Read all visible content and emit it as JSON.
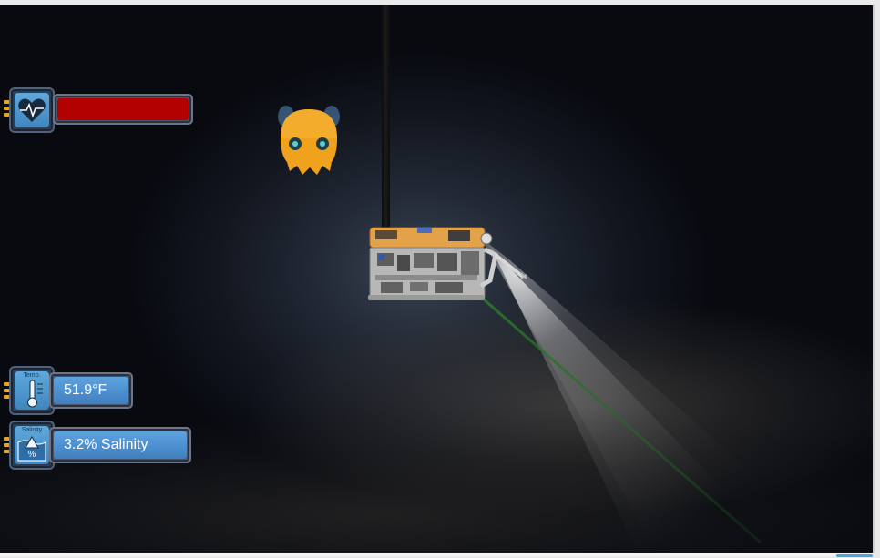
{
  "hud": {
    "health": {
      "icon": "heart-pulse-icon",
      "level_fraction": 1.0,
      "fill_color": "#b30000"
    },
    "temperature": {
      "icon_caption": "Temp.",
      "icon": "thermometer-icon",
      "value": "51.9°F"
    },
    "salinity": {
      "icon_caption": "Salinity",
      "icon": "salinity-water-icon",
      "icon_symbol": "%",
      "value": "3.2% Salinity"
    }
  },
  "scene": {
    "creature": "dumbo-octopus",
    "vehicle": "rov-submersible",
    "colors": {
      "rov_orange": "#e3a24a",
      "octopus_orange": "#f0a21c",
      "panel_blue": "#4f90cf"
    }
  }
}
